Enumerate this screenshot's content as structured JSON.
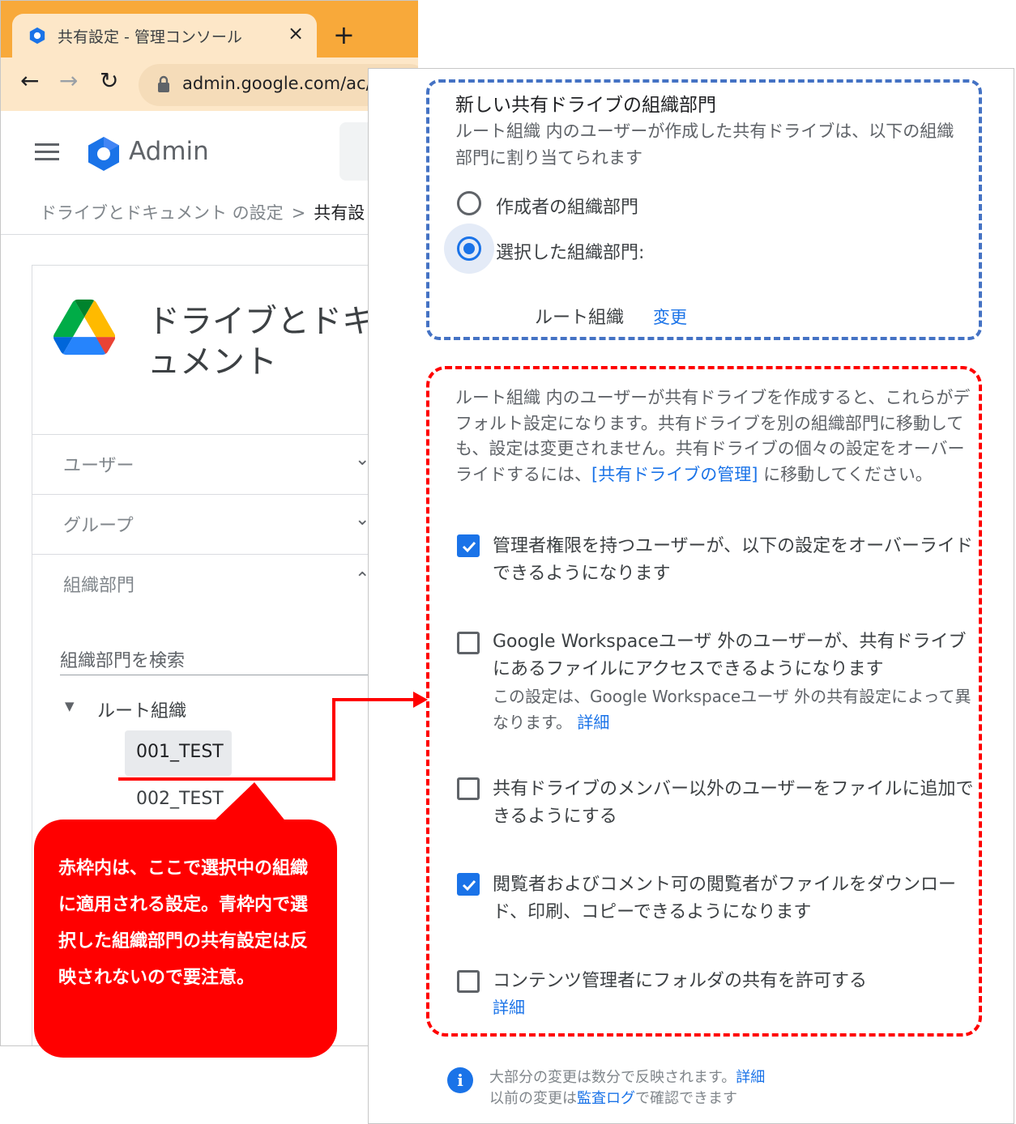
{
  "browser": {
    "tab_title": "共有設定 - 管理コンソール",
    "tab_close": "×",
    "new_tab": "+",
    "url": "admin.google.com/ac/m",
    "back": "←",
    "forward": "→",
    "reload": "↻"
  },
  "admin": {
    "app_name": "Admin",
    "breadcrumb_parent": "ドライブとドキュメント の設定",
    "breadcrumb_sep": ">",
    "breadcrumb_current": "共有設"
  },
  "card": {
    "title": "ドライブとドキュメント",
    "accordion": [
      {
        "label": "ユーザー",
        "chevron": "⌄"
      },
      {
        "label": "グループ",
        "chevron": "⌄"
      },
      {
        "label": "組織部門",
        "chevron": "⌃"
      }
    ],
    "org_search_placeholder": "組織部門を検索",
    "tree": {
      "caret": "▼",
      "root": "ルート組織",
      "children": [
        "001_TEST",
        "002_TEST"
      ]
    }
  },
  "shared_drive_ou": {
    "title": "新しい共有ドライブの組織部門",
    "description": "ルート組織 内のユーザーが作成した共有ドライブは、以下の組織部門に割り当てられます",
    "option_creator": "作成者の組織部門",
    "option_selected": "選択した組織部門:",
    "selected_org": "ルート組織",
    "change_link": "変更"
  },
  "defaults": {
    "desc_before": "ルート組織 内のユーザーが共有ドライブを作成すると、これらがデフォルト設定になります。共有ドライブを別の組織部門に移動しても、設定は変更されません。共有ドライブの個々の設定をオーバーライドするには、",
    "desc_link": "[共有ドライブの管理]",
    "desc_after": " に移動してください。",
    "options": [
      {
        "checked": true,
        "label": "管理者権限を持つユーザーが、以下の設定をオーバーライドできるようになります"
      },
      {
        "checked": false,
        "label": "Google Workspaceユーザ 外のユーザーが、共有ドライブにあるファイルにアクセスできるようになります",
        "sub": "この設定は、Google Workspaceユーザ 外の共有設定によって異なります。",
        "sub_link": "詳細"
      },
      {
        "checked": false,
        "label": "共有ドライブのメンバー以外のユーザーをファイルに追加できるようにする"
      },
      {
        "checked": true,
        "label": "閲覧者およびコメント可の閲覧者がファイルをダウンロード、印刷、コピーできるようになります"
      },
      {
        "checked": false,
        "label": "コンテンツ管理者にフォルダの共有を許可する",
        "sub_link": "詳細"
      }
    ]
  },
  "footer": {
    "line1": "大部分の変更は数分で反映されます。",
    "line1_link": "詳細",
    "line2_before": "以前の変更は",
    "line2_link": "監査ログ",
    "line2_after": "で確認できます"
  },
  "callout": {
    "text": "赤枠内は、ここで選択中の組織に適用される設定。青枠内で選択した組織部門の共有設定は反映されないので要注意。"
  },
  "colors": {
    "blue_frame": "#4472c4",
    "red_frame": "#ff0000",
    "accent": "#1a73e8",
    "tab_bar": "#f8a93a",
    "tab_active": "#fde7c8"
  }
}
